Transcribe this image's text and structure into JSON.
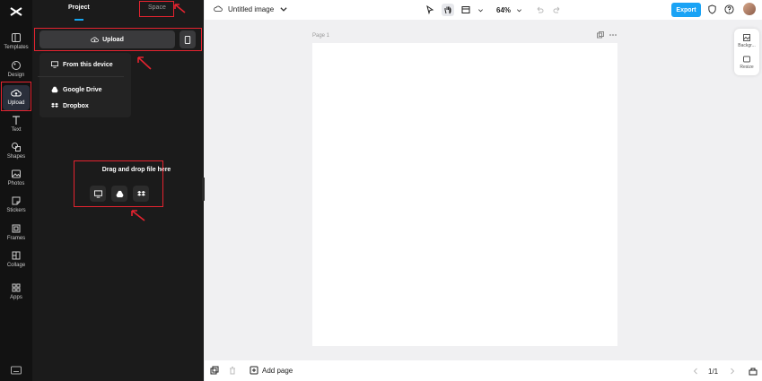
{
  "app": {
    "document_title": "Untitled image",
    "zoom_level": "64%",
    "export_label": "Export"
  },
  "sidebar": {
    "items": [
      {
        "label": "Templates",
        "icon": "templates-icon"
      },
      {
        "label": "Design",
        "icon": "design-icon"
      },
      {
        "label": "Upload",
        "icon": "upload-cloud-icon"
      },
      {
        "label": "Text",
        "icon": "text-icon"
      },
      {
        "label": "Shapes",
        "icon": "shapes-icon"
      },
      {
        "label": "Photos",
        "icon": "photos-icon"
      },
      {
        "label": "Stickers",
        "icon": "stickers-icon"
      },
      {
        "label": "Frames",
        "icon": "frames-icon"
      },
      {
        "label": "Collage",
        "icon": "collage-icon"
      },
      {
        "label": "Apps",
        "icon": "apps-icon"
      }
    ]
  },
  "panel": {
    "tabs": {
      "project": "Project",
      "space": "Space"
    },
    "upload_label": "Upload",
    "dropdown": {
      "from_device": "From this device",
      "google_drive": "Google Drive",
      "dropbox": "Dropbox"
    },
    "drop_zone_text": "Drag and drop file here"
  },
  "canvas": {
    "page_label": "Page 1",
    "side_tools": {
      "background": "Backgr...",
      "resize": "Resize"
    }
  },
  "footer": {
    "add_page_label": "Add page",
    "page_count": "1/1"
  },
  "colors": {
    "accent": "#1aa3f5",
    "highlight": "#e5232f",
    "sidebar_bg": "#121212",
    "panel_bg": "#1b1b1b"
  }
}
